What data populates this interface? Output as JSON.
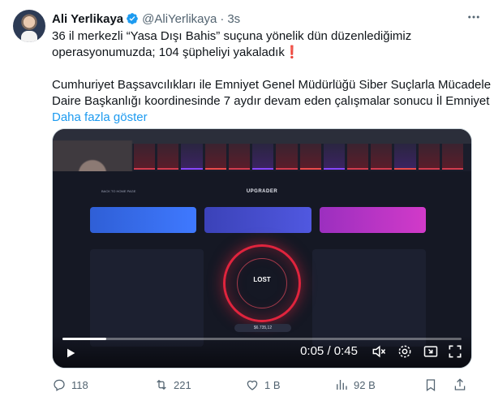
{
  "author": {
    "name": "Ali Yerlikaya",
    "handle": "@AliYerlikaya",
    "separator": "·",
    "time": "3s",
    "verified_icon": "verified-badge-icon"
  },
  "tweet": {
    "line1": "36 il merkezli “Yasa Dışı Bahis” suçuna yönelik dün düzenlediğimiz",
    "line2": "operasyonumuzda; 104 şüpheliyi yakaladık",
    "line2_emoji": "❗",
    "line3": "Cumhuriyet Başsavcılıkları ile Emniyet Genel Müdürlüğü Siber Suçlarla Mücadele",
    "line4": "Daire Başkanlığı koordinesinde 7 aydır devam eden çalışmalar sonucu İl Emniyet",
    "show_more": "Daha fazla göster"
  },
  "video": {
    "screen": {
      "page_title": "UPGRADER",
      "back_label": "BACK TO HOME PAGE",
      "result_label": "LOST",
      "amount": "$6.735,12"
    },
    "player": {
      "current_time": "0:05",
      "separator": "/",
      "duration": "0:45",
      "progress": 0.11
    }
  },
  "actions": {
    "replies": "118",
    "retweets": "221",
    "likes": "1 B",
    "views": "92 B"
  },
  "colors": {
    "link": "#1d9bf0",
    "secondary_text": "#536471",
    "verified": "#1d9bf0"
  }
}
